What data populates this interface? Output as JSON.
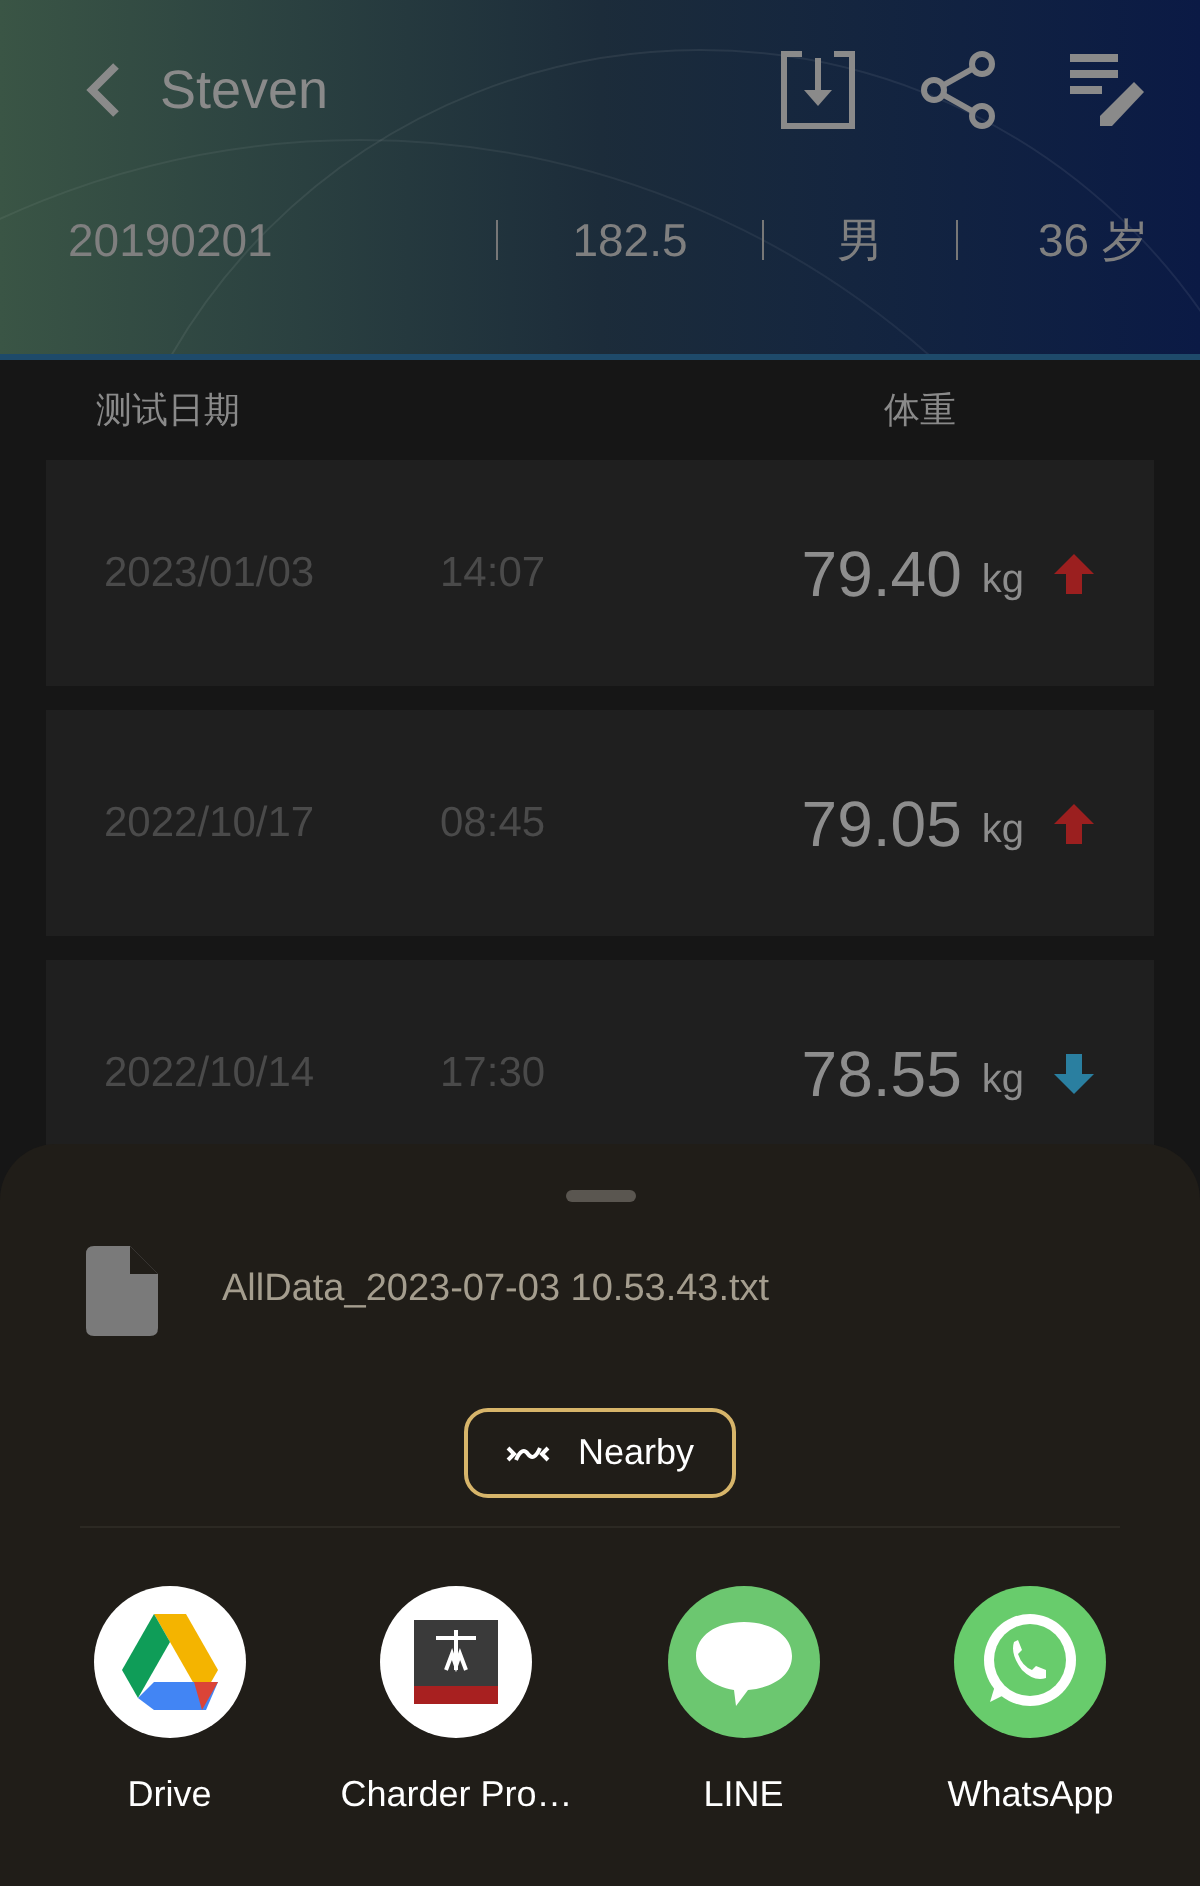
{
  "header": {
    "title": "Steven",
    "info": [
      "20190201",
      "182.5",
      "男",
      "36 岁"
    ]
  },
  "columns": [
    "测试日期",
    "体重"
  ],
  "records": [
    {
      "date": "2023/01/03",
      "time": "14:07",
      "weight": "79.40",
      "unit": "kg",
      "rising": true
    },
    {
      "date": "2022/10/17",
      "time": "08:45",
      "weight": "79.05",
      "unit": "kg",
      "rising": true
    },
    {
      "date": "2022/10/14",
      "time": "17:30",
      "weight": "78.55",
      "unit": "kg",
      "rising": false
    }
  ],
  "share_sheet": {
    "file_name": "AllData_2023-07-03 10.53.43.txt",
    "nearby_button": "Nearby",
    "apps": [
      {
        "kind": "drive",
        "label": "Drive"
      },
      {
        "kind": "charder",
        "label": "Charder Pro…"
      },
      {
        "kind": "line",
        "label": "LINE"
      },
      {
        "kind": "whatsapp",
        "label": "WhatsApp"
      }
    ]
  }
}
